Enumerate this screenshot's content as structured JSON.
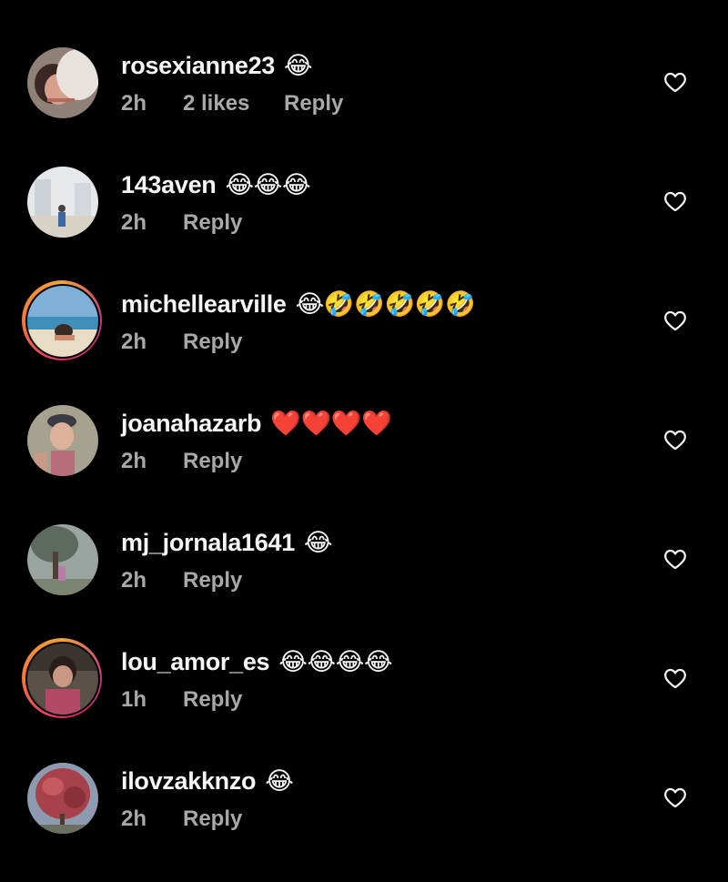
{
  "colors": {
    "background": "#000000",
    "username": "#f5f5f5",
    "meta": "#a8a8a8",
    "story_ring_start": "#f2a23c",
    "story_ring_end": "#c13584"
  },
  "comments": [
    {
      "username": "rosexianne23",
      "emoji": "😂",
      "time": "2h",
      "likes": "2 likes",
      "reply": "Reply",
      "has_story_ring": false,
      "like_icon": "heart-outline-icon"
    },
    {
      "username": "143aven",
      "emoji": "😂😂😂",
      "time": "2h",
      "likes": "",
      "reply": "Reply",
      "has_story_ring": false,
      "like_icon": "heart-outline-icon"
    },
    {
      "username": "michellearville",
      "emoji": "😂🤣🤣🤣🤣🤣",
      "time": "2h",
      "likes": "",
      "reply": "Reply",
      "has_story_ring": true,
      "like_icon": "heart-outline-icon"
    },
    {
      "username": "joanahazarb",
      "emoji": "❤️❤️❤️❤️",
      "time": "2h",
      "likes": "",
      "reply": "Reply",
      "has_story_ring": false,
      "like_icon": "heart-outline-icon"
    },
    {
      "username": "mj_jornala1641",
      "emoji": "😂",
      "time": "2h",
      "likes": "",
      "reply": "Reply",
      "has_story_ring": false,
      "like_icon": "heart-outline-icon"
    },
    {
      "username": "lou_amor_es",
      "emoji": "😂😂😂😂",
      "time": "1h",
      "likes": "",
      "reply": "Reply",
      "has_story_ring": true,
      "like_icon": "heart-outline-icon"
    },
    {
      "username": "ilovzakknzo",
      "emoji": "😂",
      "time": "2h",
      "likes": "",
      "reply": "Reply",
      "has_story_ring": false,
      "like_icon": "heart-outline-icon"
    }
  ]
}
